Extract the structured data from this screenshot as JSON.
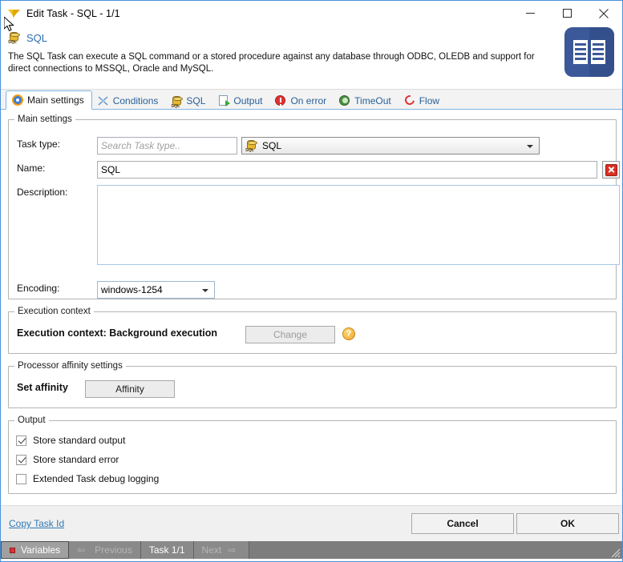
{
  "window": {
    "title": "Edit Task - SQL - 1/1",
    "icon": "app-logo-icon",
    "minimize_label": "—",
    "maximize_label": "□",
    "close_label": "✕"
  },
  "header": {
    "icon": "sql-database-icon",
    "title": "SQL",
    "description": "The SQL Task can execute a SQL command or a stored procedure against any database through ODBC, OLEDB and support for direct connections to MSSQL, Oracle and MySQL.",
    "doc_icon": "book-documentation-icon"
  },
  "tabs": [
    {
      "label": "Main settings",
      "icon": "gear-icon",
      "active": true
    },
    {
      "label": "Conditions",
      "icon": "conditions-icon",
      "active": false
    },
    {
      "label": "SQL",
      "icon": "sql-database-icon",
      "active": false
    },
    {
      "label": "Output",
      "icon": "output-export-icon",
      "active": false
    },
    {
      "label": "On error",
      "icon": "error-exclamation-icon",
      "active": false
    },
    {
      "label": "TimeOut",
      "icon": "timeout-clock-icon",
      "active": false
    },
    {
      "label": "Flow",
      "icon": "flow-arrow-icon",
      "active": false
    }
  ],
  "main_settings": {
    "legend": "Main settings",
    "task_type_label": "Task type:",
    "task_type_search_placeholder": "Search Task type..",
    "task_type_search_value": "",
    "task_type_selected": "SQL",
    "task_type_icon": "sql-database-icon",
    "name_label": "Name:",
    "name_value": "SQL",
    "clear_name_icon": "red-close-icon",
    "description_label": "Description:",
    "description_value": "",
    "encoding_label": "Encoding:",
    "encoding_value": "windows-1254"
  },
  "execution_context": {
    "legend": "Execution context",
    "status": "Execution context: Background execution",
    "change_button": "Change",
    "help_icon": "help-question-icon"
  },
  "processor_affinity": {
    "legend": "Processor affinity settings",
    "label": "Set affinity",
    "button": "Affinity"
  },
  "output": {
    "legend": "Output",
    "items": [
      {
        "label": "Store standard output",
        "checked": true
      },
      {
        "label": "Store standard error",
        "checked": true
      },
      {
        "label": "Extended Task debug logging",
        "checked": false
      }
    ]
  },
  "footer": {
    "copy_task_id": "Copy Task Id",
    "cancel": "Cancel",
    "ok": "OK"
  },
  "statusbar": {
    "variables": "Variables",
    "previous": "Previous",
    "task_counter": "Task 1/1",
    "next": "Next"
  },
  "colors": {
    "accent_blue": "#2b6cb0",
    "link_blue": "#3079b5",
    "tab_border": "#7eb4e2",
    "doc_icon_blue": "#3b5998",
    "danger_red": "#d93025",
    "status_gray": "#7d7d7d"
  }
}
